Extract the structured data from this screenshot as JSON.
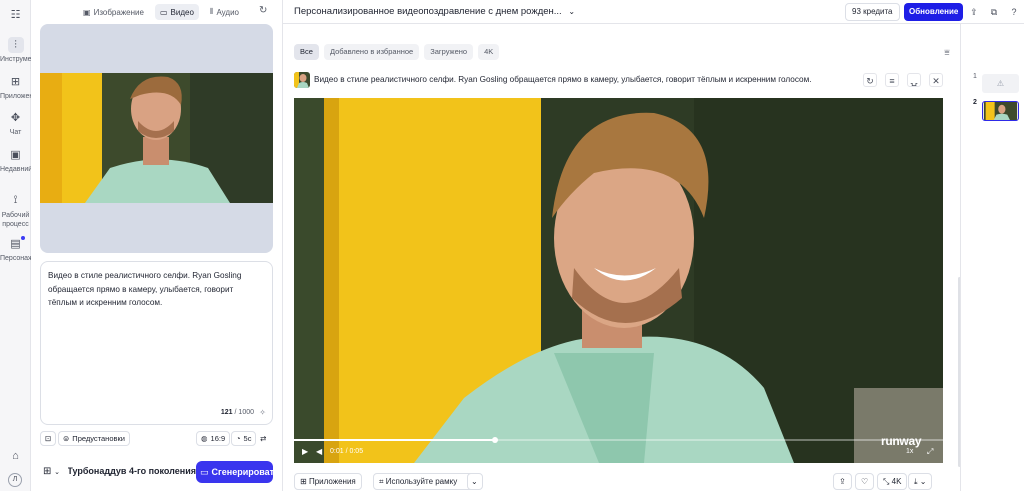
{
  "rail": {
    "items": [
      {
        "icon": "menu-grid-icon",
        "glyph": "☷",
        "label": ""
      },
      {
        "icon": "sliders-icon",
        "glyph": "⫶",
        "label": "Инструмент"
      },
      {
        "icon": "apps-icon",
        "glyph": "⊞",
        "label": "Приложения"
      },
      {
        "icon": "chat-icon",
        "glyph": "✥",
        "label": "Чат"
      },
      {
        "icon": "recent-icon",
        "glyph": "▣",
        "label": "Недавний"
      },
      {
        "icon": "workflow-icon",
        "glyph": "⟟",
        "label": "Рабочий процесс"
      },
      {
        "icon": "characters-icon",
        "glyph": "▤",
        "label": "Персонажи"
      },
      {
        "icon": "home-icon",
        "glyph": "⌂",
        "label": ""
      }
    ],
    "avatar_letter": "Л"
  },
  "panel": {
    "tabs": [
      {
        "icon": "▣",
        "label": "Изображение"
      },
      {
        "icon": "▭",
        "label": "Видео"
      },
      {
        "icon": "⦀",
        "label": "Аудио"
      }
    ],
    "active_tab": "Видео",
    "prompt": "Видео в стиле реалистичного селфи. Ryan Gosling обращается прямо в камеру, улыбается, говорит тёплым и искренним голосом.",
    "char_count_current": "121",
    "char_count_max": "/ 1000",
    "presets_label": "Предустановки",
    "aspect_ratio": "16:9",
    "duration": "5с",
    "model_name": "Турбонаддув 4-го поколения",
    "generate_label": "Сгенерировать"
  },
  "header": {
    "title": "Персонализированное видеопоздравление с днем рожден...",
    "credits": "93 кредита",
    "upgrade_label": "Обновление"
  },
  "filters": [
    "Все",
    "Добавлено в избранное",
    "Загружено",
    "4K"
  ],
  "active_filter": "Все",
  "generation": {
    "caption": "Видео в стиле реалистичного селфи. Ryan Gosling обращается прямо в камеру, улыбается, говорит тёплым и искренним голосом.",
    "time": "0:01 / 0:05",
    "watermark": "runway",
    "speed": "1x",
    "progress": 0.31
  },
  "bottom_tools": {
    "apps_label": "Приложения",
    "frame_label": "Используйте рамку",
    "quality": "4K"
  },
  "thumbnails": {
    "items": [
      {
        "num": "1"
      },
      {
        "num": "2"
      }
    ]
  },
  "colors": {
    "accent": "#3a35ee",
    "upgrade": "#1e1ee6",
    "yellow_wall": "#f2c31a",
    "jacket": "#a9d7c2"
  }
}
